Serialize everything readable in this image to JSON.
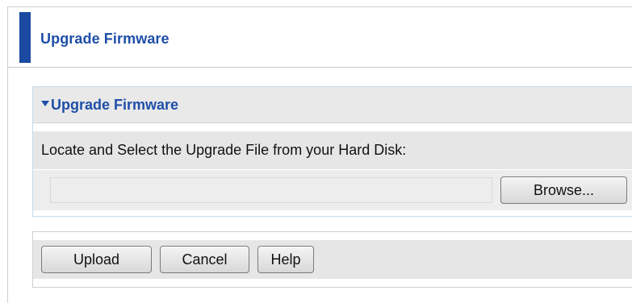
{
  "header": {
    "title": "Upgrade Firmware"
  },
  "section": {
    "title": "Upgrade Firmware",
    "arrow_icon": "triangle-down-icon",
    "locate_label": "Locate and Select the Upgrade File from your Hard Disk:",
    "file_input": {
      "value": "",
      "placeholder": ""
    },
    "browse_label": "Browse..."
  },
  "actions": {
    "upload_label": "Upload",
    "cancel_label": "Cancel",
    "help_label": "Help"
  },
  "colors": {
    "accent": "#1a4aa2",
    "title_text": "#1f4ea8",
    "panel_bg": "#e6e6e6"
  }
}
